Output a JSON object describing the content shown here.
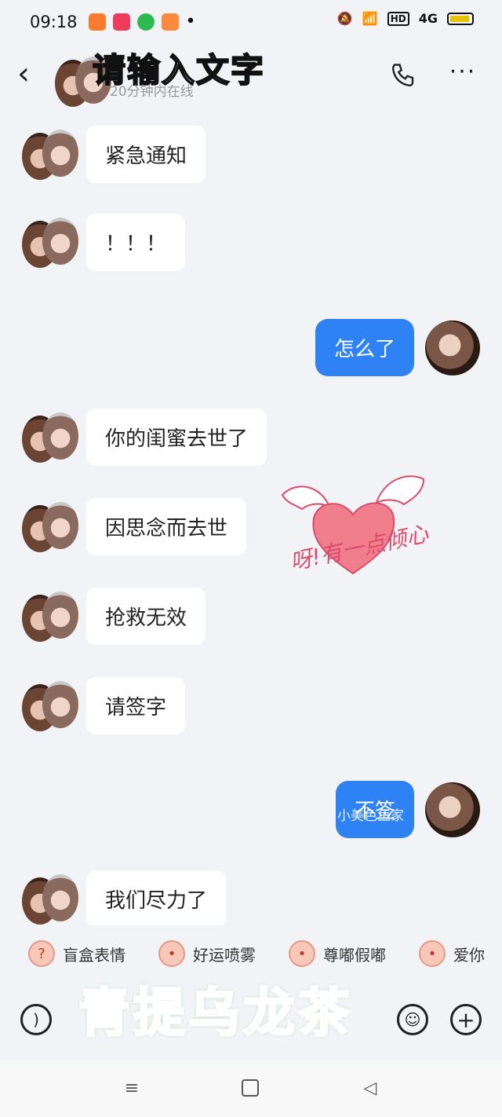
{
  "status_bar": {
    "time": "09:18",
    "signal_label": "4G",
    "hd_label": "HD",
    "app_icon_colors": [
      "#ff7a2d",
      "#ef3b5c",
      "#2dbb4f",
      "#ff8a3d"
    ]
  },
  "header": {
    "overlay_title": "请输入文字",
    "presence": "20分钟内在线",
    "back_icon": "chevron-left-icon",
    "call_icon": "phone-icon",
    "more_icon": "more-dots-icon"
  },
  "messages": [
    {
      "side": "in",
      "text": "紧急通知"
    },
    {
      "side": "in",
      "text": "！！！"
    },
    {
      "side": "out",
      "text": "怎么了"
    },
    {
      "side": "in",
      "text": "你的闺蜜去世了"
    },
    {
      "side": "in",
      "text": "因思念而去世"
    },
    {
      "side": "in",
      "text": "抢救无效"
    },
    {
      "side": "in",
      "text": "请签字"
    },
    {
      "side": "out",
      "text": "不签"
    },
    {
      "side": "in",
      "text": "我们尽力了"
    }
  ],
  "sticker": {
    "text": "呀!有一点倾心",
    "icon": "winged-heart-icon"
  },
  "watermark": "小美色鱼家",
  "suggestions": [
    {
      "label": "盲盒表情",
      "icon": "question-box-icon"
    },
    {
      "label": "好运喷雾",
      "icon": "pig-icon"
    },
    {
      "label": "尊嘟假嘟",
      "icon": "pig-icon"
    },
    {
      "label": "爱你",
      "icon": "pig-icon"
    }
  ],
  "bottom_overlay": "青提乌龙茶",
  "colors": {
    "outgoing_bubble": "#2f82f4",
    "incoming_bubble": "#ffffff",
    "background": "#f2f3f7",
    "overlay_green": "#7fe066"
  }
}
